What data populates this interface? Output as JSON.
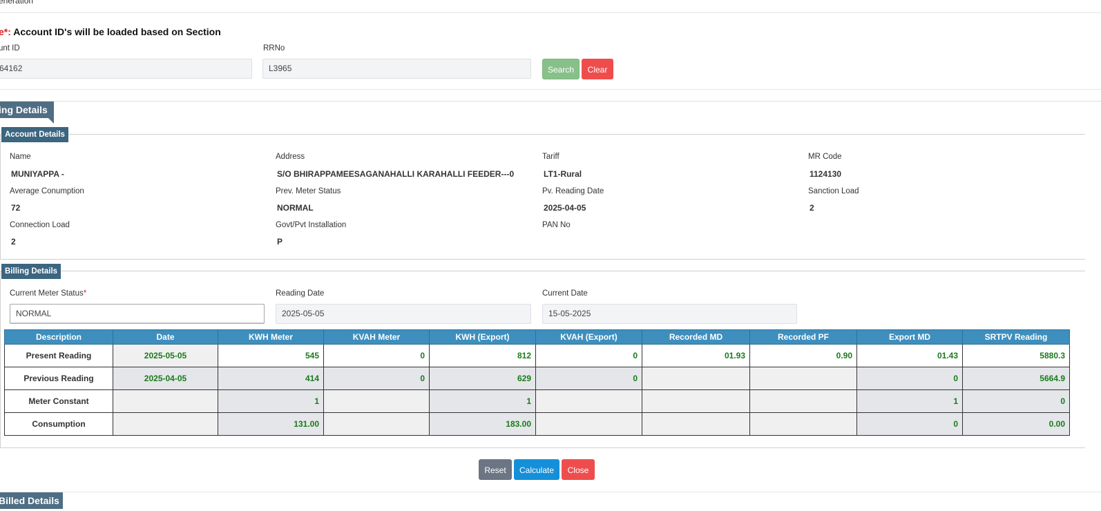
{
  "page": {
    "top_title": "eneration",
    "note_prefix": "e*:",
    "note_text": " Account ID's will be loaded based on Section"
  },
  "search": {
    "account_id_label": "unt ID",
    "account_id_value": "64162",
    "rrno_label": "RRNo",
    "rrno_value": "L3965",
    "search_label": "Search",
    "clear_label": "Clear"
  },
  "billing_details_tab": "ing Details",
  "account_details": {
    "legend": "Account Details",
    "fields": [
      {
        "label": "Name",
        "value": "MUNIYAPPA -"
      },
      {
        "label": "Address",
        "value": "S/O BHIRAPPAMEESAGANAHALLI KARAHALLI FEEDER---0"
      },
      {
        "label": "Tariff",
        "value": "LT1-Rural"
      },
      {
        "label": "MR Code",
        "value": "1124130"
      },
      {
        "label": "Average Conumption",
        "value": "72"
      },
      {
        "label": "Prev. Meter Status",
        "value": "NORMAL"
      },
      {
        "label": "Pv. Reading Date",
        "value": "2025-04-05"
      },
      {
        "label": "Sanction Load",
        "value": "2"
      },
      {
        "label": "Connection Load",
        "value": "2"
      },
      {
        "label": "Govt/Pvt Installation",
        "value": "P"
      },
      {
        "label": "PAN No",
        "value": ""
      }
    ]
  },
  "billing": {
    "legend": "Billing Details",
    "meter_status_label": "Current Meter Status",
    "required_mark": "*",
    "meter_status_value": "NORMAL",
    "reading_date_label": "Reading Date",
    "reading_date_value": "2025-05-05",
    "current_date_label": "Current Date",
    "current_date_value": "15-05-2025",
    "table": {
      "headers": [
        "Description",
        "Date",
        "KWH Meter",
        "KVAH Meter",
        "KWH (Export)",
        "KVAH (Export)",
        "Recorded MD",
        "Recorded PF",
        "Export MD",
        "SRTPV Reading"
      ],
      "rows": [
        [
          "Present Reading",
          "2025-05-05",
          "545",
          "0",
          "812",
          "0",
          "01.93",
          "0.90",
          "01.43",
          "5880.3"
        ],
        [
          "Previous Reading",
          "2025-04-05",
          "414",
          "0",
          "629",
          "0",
          "",
          "",
          "0",
          "5664.9"
        ],
        [
          "Meter Constant",
          "",
          "1",
          "",
          "1",
          "",
          "",
          "",
          "1",
          "0"
        ],
        [
          "Consumption",
          "",
          "131.00",
          "",
          "183.00",
          "",
          "",
          "",
          "0",
          "0.00"
        ]
      ]
    }
  },
  "actions": {
    "reset_label": "Reset",
    "calculate_label": "Calculate",
    "close_label": "Close"
  },
  "billed_details_tab": "Billed Details"
}
